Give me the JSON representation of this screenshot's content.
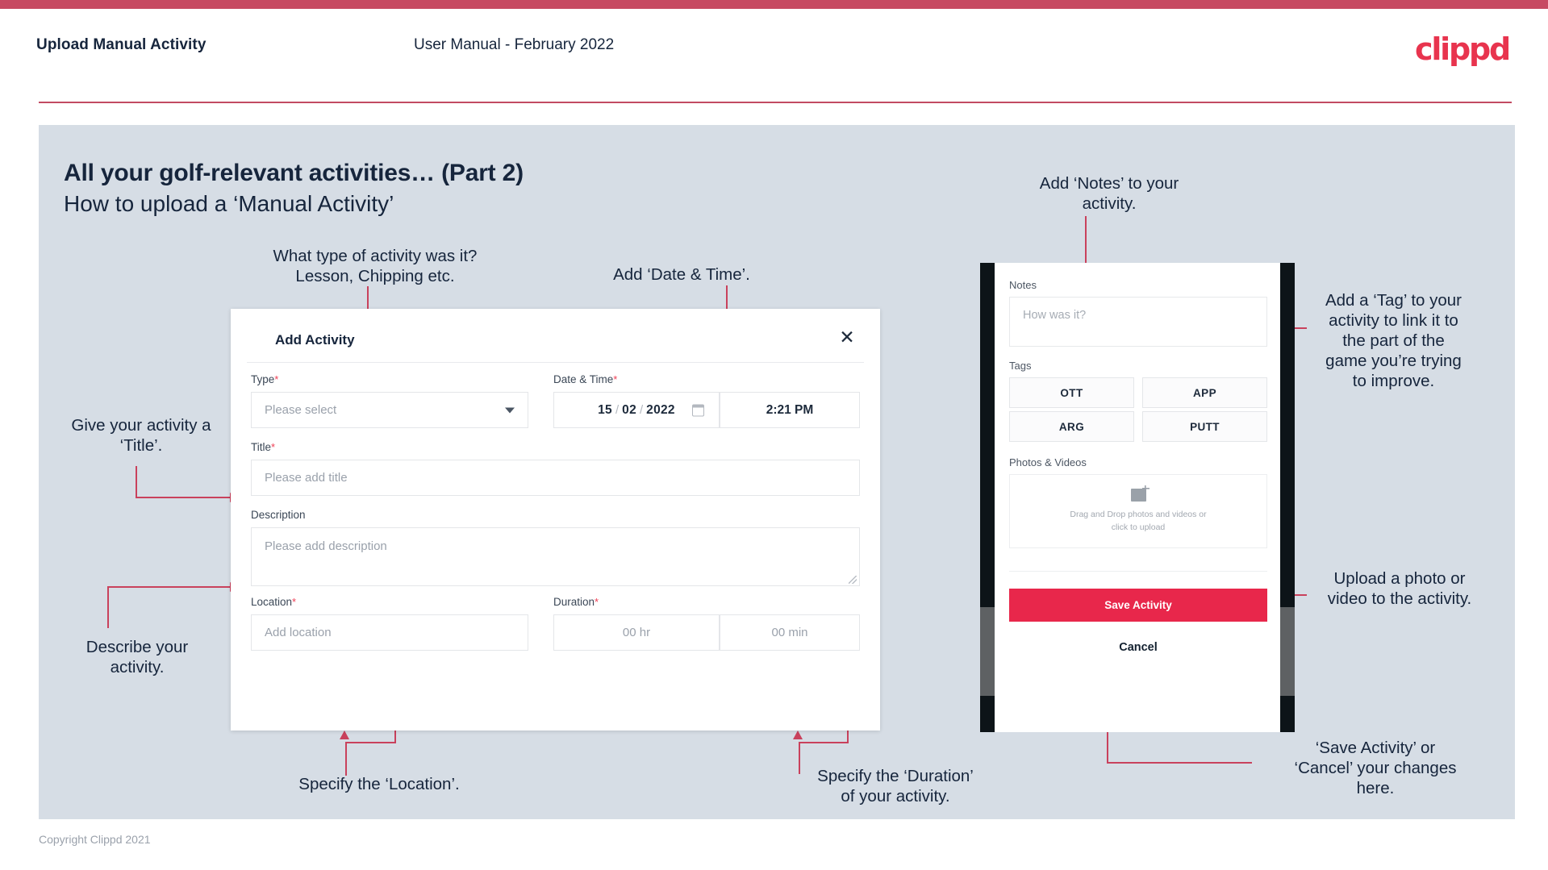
{
  "header": {
    "title": "Upload Manual Activity",
    "subtitle": "User Manual - February 2022",
    "logo": "clippd"
  },
  "slide": {
    "heading": "All your golf-relevant activities… (Part 2)",
    "subheading": "How to upload a ‘Manual Activity’"
  },
  "footer": {
    "copyright": "Copyright Clippd 2021"
  },
  "callouts": {
    "type": "What type of activity was it?\nLesson, Chipping etc.",
    "datetime": "Add ‘Date & Time’.",
    "title": "Give your activity a\n‘Title’.",
    "description": "Describe your\nactivity.",
    "location": "Specify the ‘Location’.",
    "duration": "Specify the ‘Duration’\nof your activity.",
    "notes": "Add ‘Notes’ to your\nactivity.",
    "tags": "Add a ‘Tag’ to your\nactivity to link it to\nthe part of the\ngame you’re trying\nto improve.",
    "upload": "Upload a photo or\nvideo to the activity.",
    "save": "‘Save Activity’ or\n‘Cancel’ your changes\nhere."
  },
  "dialog": {
    "title": "Add Activity",
    "close_icon": "close-icon",
    "fields": {
      "type": {
        "label": "Type",
        "required": "*",
        "placeholder": "Please select"
      },
      "datetime": {
        "label": "Date & Time",
        "required": "*",
        "day": "15",
        "month": "02",
        "year": "2022",
        "sep": "/",
        "time": "2:21 PM"
      },
      "title": {
        "label": "Title",
        "required": "*",
        "placeholder": "Please add title"
      },
      "description": {
        "label": "Description",
        "placeholder": "Please add description"
      },
      "location": {
        "label": "Location",
        "required": "*",
        "placeholder": "Add location"
      },
      "duration": {
        "label": "Duration",
        "required": "*",
        "hours": "00 hr",
        "minutes": "00 min"
      }
    }
  },
  "phone": {
    "notes": {
      "label": "Notes",
      "placeholder": "How was it?"
    },
    "tags": {
      "label": "Tags",
      "items": [
        "OTT",
        "APP",
        "ARG",
        "PUTT"
      ]
    },
    "media": {
      "label": "Photos & Videos",
      "drop_line1": "Drag and Drop photos and videos or",
      "drop_line2": "click to upload"
    },
    "save_label": "Save Activity",
    "cancel_label": "Cancel"
  },
  "colors": {
    "brand_pink": "#e8274b",
    "topbar": "#c74a62",
    "arrow": "#c9415c",
    "panel_bg": "#d6dde5",
    "text_dark": "#16253c"
  }
}
